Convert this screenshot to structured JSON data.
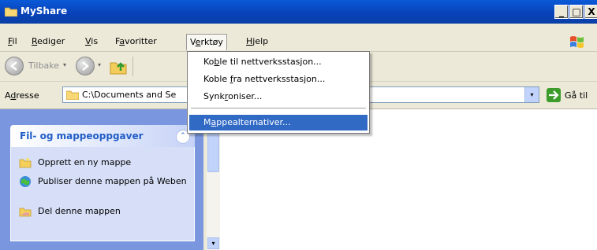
{
  "window": {
    "title": "MyShare",
    "min_label": "_",
    "max_label": "□",
    "close_label": "X"
  },
  "menubar": {
    "items": [
      {
        "pre": "",
        "key": "F",
        "post": "il"
      },
      {
        "pre": "",
        "key": "R",
        "post": "ediger"
      },
      {
        "pre": "",
        "key": "V",
        "post": "is"
      },
      {
        "pre": "F",
        "key": "a",
        "post": "voritter"
      },
      {
        "pre": "V",
        "key": "e",
        "post": "rktøy"
      },
      {
        "pre": "",
        "key": "H",
        "post": "jelp"
      }
    ]
  },
  "toolbar": {
    "back_label": "Tilbake",
    "dropdown_glyph": "▾"
  },
  "address": {
    "label_pre": "A",
    "label_key": "d",
    "label_post": "resse",
    "value": "C:\\Documents and Se",
    "go_label": "Gå til",
    "dropdown_glyph": "▾"
  },
  "tools_menu": {
    "items": [
      {
        "pre": "Ko",
        "key": "b",
        "post": "le til nettverksstasjon..."
      },
      {
        "pre": "Koble ",
        "key": "f",
        "post": "ra nettverksstasjon..."
      },
      {
        "pre": "Synk",
        "key": "r",
        "post": "oniser..."
      },
      {
        "pre": "M",
        "key": "a",
        "post": "ppealternativer..."
      }
    ],
    "highlighted_index": 3
  },
  "tasks": {
    "header": "Fil- og mappeoppgaver",
    "collapse_glyph": "⌃",
    "items": [
      {
        "label": "Opprett en ny mappe"
      },
      {
        "label": "Publiser denne mappen på Weben"
      },
      {
        "label": "Del denne mappen"
      }
    ]
  },
  "colors": {
    "titlebar": "#0842b9",
    "menu_highlight": "#316ac5",
    "task_pane": "#7a96df"
  }
}
